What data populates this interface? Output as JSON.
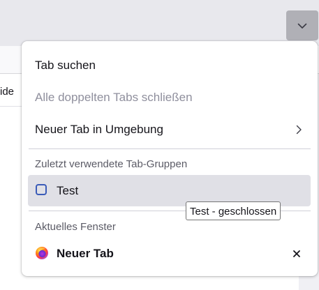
{
  "background": {
    "content_fragment": "ide"
  },
  "menu": {
    "search_tabs": "Tab suchen",
    "close_duplicates": "Alle doppelten Tabs schließen",
    "new_tab_nearby": "Neuer Tab in Umgebung"
  },
  "recent_groups": {
    "header": "Zuletzt verwendete Tab-Gruppen",
    "groups": [
      {
        "label": "Test",
        "color": "#3a5bb8"
      }
    ]
  },
  "tooltip": {
    "text": "Test - geschlossen"
  },
  "current_window": {
    "header": "Aktuelles Fenster",
    "tabs": [
      {
        "title": "Neuer Tab",
        "icon": "firefox-icon"
      }
    ]
  },
  "icons": {
    "list_all_tabs": "chevron-down-icon",
    "submenu": "chevron-right-icon",
    "close": "close-icon"
  }
}
